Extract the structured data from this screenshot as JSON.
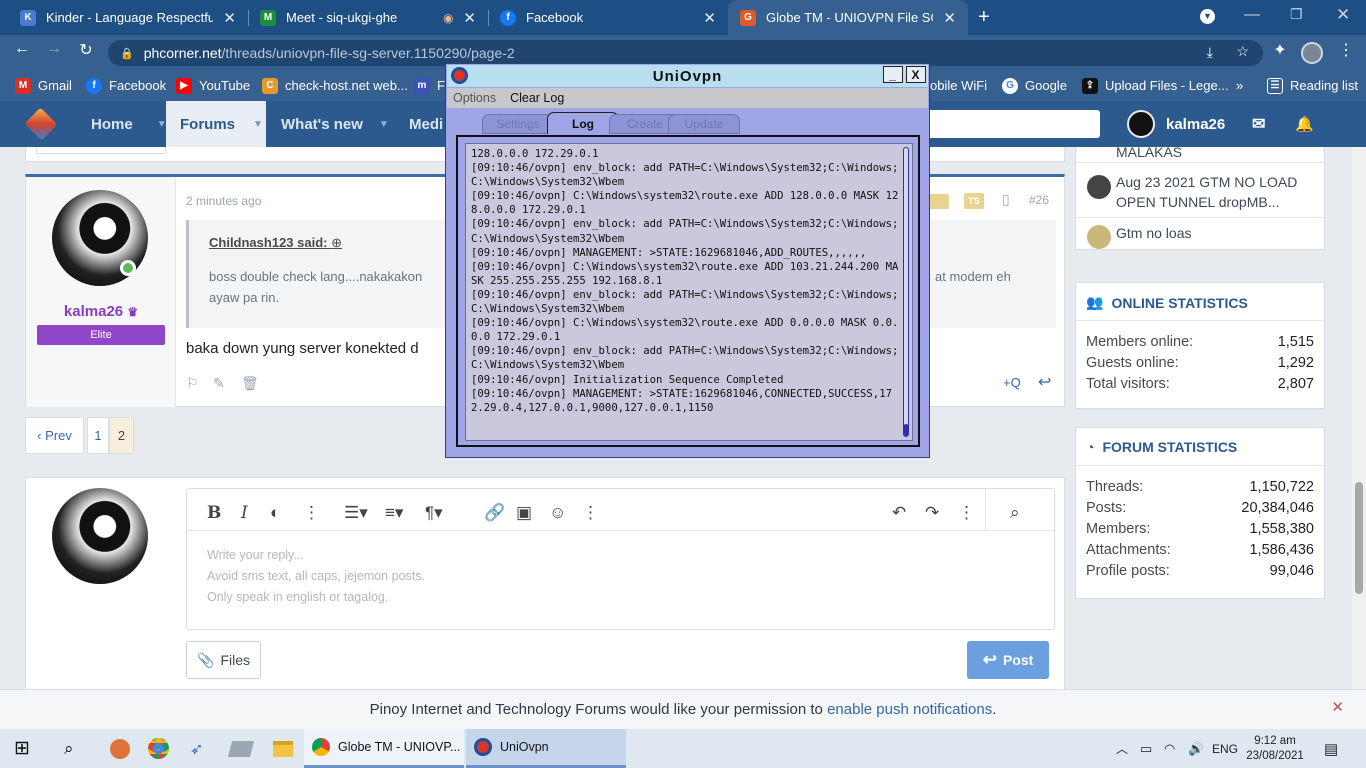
{
  "browser": {
    "tabs": [
      {
        "title": "Kinder - Language Respectful",
        "favicon": "K",
        "color": "#4a7bd1",
        "active": false
      },
      {
        "title": "Meet - siq-ukgi-ghe",
        "favicon": "M",
        "color": "#1e8e3e",
        "active": false
      },
      {
        "title": "Facebook",
        "favicon": "f",
        "color": "#1877f2",
        "active": false
      },
      {
        "title": "Globe TM - UNIOVPN File SG SE",
        "favicon": "G",
        "color": "#e05a2b",
        "active": true
      }
    ],
    "url_domain": "phcorner.net",
    "url_path": "/threads/uniovpn-file-sg-server.1150290/page-2",
    "bookmarks": [
      {
        "label": "Gmail",
        "icon": "M",
        "color": "#d93025"
      },
      {
        "label": "Facebook",
        "icon": "f",
        "color": "#1877f2"
      },
      {
        "label": "YouTube",
        "icon": "▶",
        "color": "#ff0000"
      },
      {
        "label": "check-host.net web...",
        "icon": "C",
        "color": "#e39a2b"
      },
      {
        "label": "F",
        "icon": "m",
        "color": "#3f51b5"
      },
      {
        "label": "obile WiFi",
        "icon": "",
        "color": "#35608f"
      },
      {
        "label": "Google",
        "icon": "G",
        "color": "#4285f4"
      },
      {
        "label": "Upload Files - Lege...",
        "icon": "⇪",
        "color": "#111111"
      },
      {
        "label": "Reading list",
        "icon": "☰",
        "color": "#35608f"
      }
    ]
  },
  "site_nav": {
    "items": [
      "Home",
      "Forums",
      "What's new",
      "Medi"
    ],
    "active": "Forums",
    "username": "kalma26"
  },
  "post": {
    "time": "2 minutes ago",
    "post_number": "#26",
    "badges": [
      "TS"
    ],
    "author": "kalma26",
    "author_rank": "Elite",
    "quote_author": "Childnash123 said:",
    "quote_text_start": "boss double check lang....nakakakon",
    "quote_text_end": "at modem eh",
    "quote_text_line2": "ayaw pa rin.",
    "body": "baka down yung server konekted d",
    "actions_right": [
      "+Q",
      "↩"
    ]
  },
  "pagination": {
    "prev": "‹ Prev",
    "pages": [
      "1",
      "2"
    ],
    "current": "2"
  },
  "editor": {
    "placeholder_lines": [
      "Write your reply...",
      "Avoid sms text, all caps, jejemon posts.",
      "Only speak in english or tagalog."
    ],
    "files_label": "Files",
    "post_label": "Post"
  },
  "sidebar": {
    "recent_threads": [
      {
        "title": "MALAKAS"
      },
      {
        "title": "Aug 23 2021 GTM NO LOAD OPEN TUNNEL dropMB..."
      },
      {
        "title": "Gtm no loas"
      }
    ],
    "online_stats": {
      "title": "ONLINE STATISTICS",
      "rows": [
        {
          "label": "Members online:",
          "value": "1,515"
        },
        {
          "label": "Guests online:",
          "value": "1,292"
        },
        {
          "label": "Total visitors:",
          "value": "2,807"
        }
      ]
    },
    "forum_stats": {
      "title": "FORUM STATISTICS",
      "rows": [
        {
          "label": "Threads:",
          "value": "1,150,722"
        },
        {
          "label": "Posts:",
          "value": "20,384,046"
        },
        {
          "label": "Members:",
          "value": "1,558,380"
        },
        {
          "label": "Attachments:",
          "value": "1,586,436"
        },
        {
          "label": "Profile posts:",
          "value": "99,046"
        }
      ]
    }
  },
  "notice": {
    "text": "Pinoy Internet and Technology Forums would like your permission to",
    "link": "enable push notifications",
    "suffix": "."
  },
  "vpn_window": {
    "title": "UniOvpn",
    "menu": [
      "Options",
      "Clear Log"
    ],
    "tabs": [
      "Settings",
      "Log",
      "Create",
      "Update"
    ],
    "active_tab": "Log",
    "log": "128.0.0.0 172.29.0.1\n[09:10:46/ovpn] env_block: add PATH=C:\\Windows\\System32;C:\\Windows;C:\\Windows\\System32\\Wbem\n[09:10:46/ovpn] C:\\Windows\\system32\\route.exe ADD 128.0.0.0 MASK 128.0.0.0 172.29.0.1\n[09:10:46/ovpn] env_block: add PATH=C:\\Windows\\System32;C:\\Windows;C:\\Windows\\System32\\Wbem\n[09:10:46/ovpn] MANAGEMENT: >STATE:1629681046,ADD_ROUTES,,,,,,\n[09:10:46/ovpn] C:\\Windows\\system32\\route.exe ADD 103.21.244.200 MASK 255.255.255.255 192.168.8.1\n[09:10:46/ovpn] env_block: add PATH=C:\\Windows\\System32;C:\\Windows;C:\\Windows\\System32\\Wbem\n[09:10:46/ovpn] C:\\Windows\\system32\\route.exe ADD 0.0.0.0 MASK 0.0.0.0 172.29.0.1\n[09:10:46/ovpn] env_block: add PATH=C:\\Windows\\System32;C:\\Windows;C:\\Windows\\System32\\Wbem\n[09:10:46/ovpn] Initialization Sequence Completed\n[09:10:46/ovpn] MANAGEMENT: >STATE:1629681046,CONNECTED,SUCCESS,172.29.0.4,127.0.0.1,9000,127.0.0.1,1150"
  },
  "taskbar": {
    "apps": [
      {
        "label": "Globe TM - UNIOVP...",
        "icon": "chrome"
      },
      {
        "label": "UniOvpn",
        "icon": "uniovpn"
      }
    ],
    "language": "ENG",
    "time": "9:12 am",
    "date": "23/08/2021"
  }
}
